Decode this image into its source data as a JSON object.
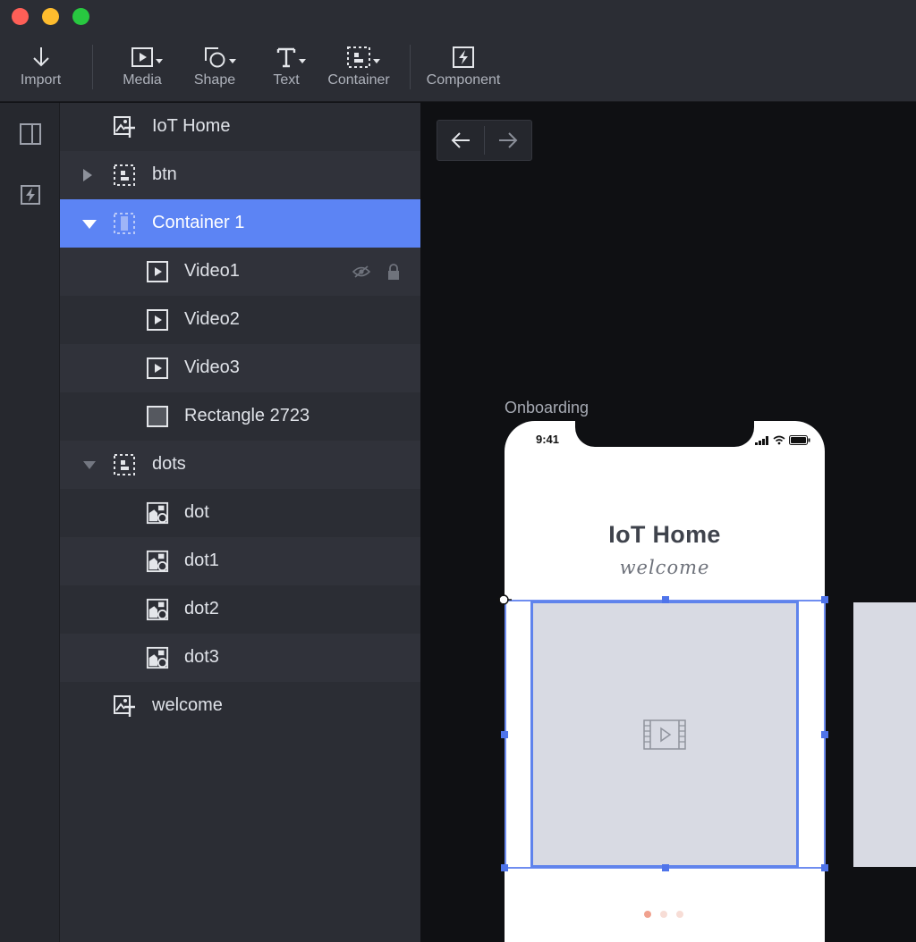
{
  "toolbar": {
    "import_label": "Import",
    "media_label": "Media",
    "shape_label": "Shape",
    "text_label": "Text",
    "container_label": "Container",
    "component_label": "Component"
  },
  "layers": {
    "rows": [
      {
        "name": "IoT Home",
        "icon": "image-text-icon",
        "indent": 0
      },
      {
        "name": "btn",
        "icon": "container-icon",
        "indent": 0,
        "expanded": false
      },
      {
        "name": "Container 1",
        "icon": "container-icon",
        "indent": 0,
        "expanded": true,
        "selected": true
      },
      {
        "name": "Video1",
        "icon": "video-icon",
        "indent": 1,
        "hidden": true,
        "locked": true
      },
      {
        "name": "Video2",
        "icon": "video-icon",
        "indent": 1
      },
      {
        "name": "Video3",
        "icon": "video-icon",
        "indent": 1
      },
      {
        "name": "Rectangle 2723",
        "icon": "rectangle-icon",
        "indent": 1
      },
      {
        "name": "dots",
        "icon": "container-icon",
        "indent": 0,
        "expanded": true
      },
      {
        "name": "dot",
        "icon": "image-shape-icon",
        "indent": 1
      },
      {
        "name": "dot1",
        "icon": "image-shape-icon",
        "indent": 1
      },
      {
        "name": "dot2",
        "icon": "image-shape-icon",
        "indent": 1
      },
      {
        "name": "dot3",
        "icon": "image-shape-icon",
        "indent": 1
      },
      {
        "name": "welcome",
        "icon": "image-text-icon",
        "indent": 0
      }
    ]
  },
  "canvas": {
    "artboard_label": "Onboarding",
    "status_time": "9:41",
    "app_title": "IoT Home",
    "app_subtitle": "welcome",
    "page_dots": 3,
    "active_dot": 0
  },
  "colors": {
    "accent": "#5c84f4",
    "selection": "#5f83ec",
    "dot_active": "#f0a18e",
    "dot_inactive": "#f7ddd6"
  }
}
